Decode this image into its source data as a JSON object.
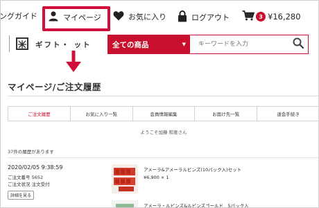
{
  "nav": {
    "guide": "ングガイド",
    "mypage": "マイページ",
    "favorites": "お気に入り",
    "logout": "ログアウト",
    "cart_count": "3",
    "cart_total": "¥16,280"
  },
  "logo_text": "ギフト・ ット",
  "search": {
    "category": "全ての商品",
    "placeholder": "キーワードを入力"
  },
  "page": {
    "title": "マイページ/ご注文履歴",
    "tabs": [
      {
        "label": "ご注文履歴",
        "active": true
      },
      {
        "label": "お気に入り一覧",
        "active": false
      },
      {
        "label": "会員情報編集",
        "active": false
      },
      {
        "label": "お届け先一覧",
        "active": false
      },
      {
        "label": "退会手続き",
        "active": false
      }
    ],
    "welcome": "ようこそ加藤 和恵さん",
    "history_count": "37件の履歴があります"
  },
  "orders": [
    {
      "date": "2020/02/05 9:38:59",
      "order_no": "ご注文番号 5652",
      "status": "ご注文状況 注文受付",
      "detail_label": "詳細を見る",
      "product_name": "アメーラ&アメーラルビンズ(10パック入)セット",
      "product_price": "¥6,900 × 1"
    },
    {
      "product_name": "アメーラ・ルビンズ&ルビンズゴールド　5パック入"
    }
  ],
  "colors": {
    "accent": "#c8102e",
    "highlight": "#d0103a"
  }
}
